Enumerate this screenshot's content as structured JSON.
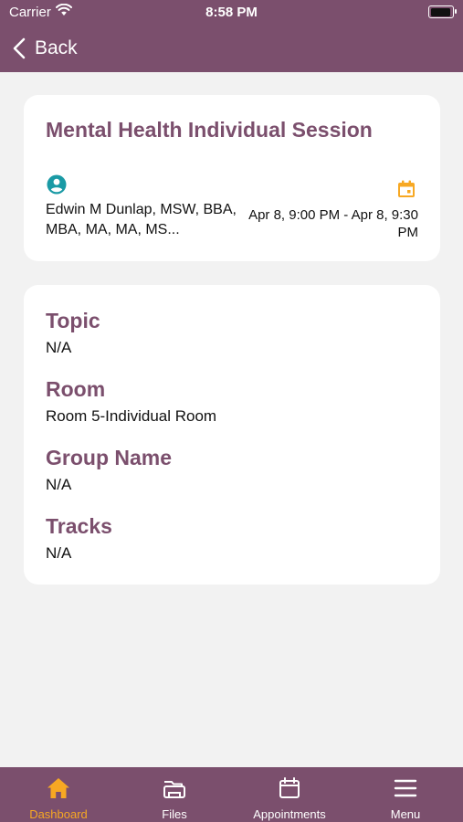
{
  "status_bar": {
    "carrier": "Carrier",
    "time": "8:58 PM"
  },
  "nav": {
    "back_label": "Back"
  },
  "session": {
    "title": "Mental Health Individual Session",
    "provider": "Edwin M Dunlap, MSW, BBA, MBA, MA, MA, MS...",
    "datetime": "Apr 8, 9:00 PM - Apr 8, 9:30 PM"
  },
  "details": [
    {
      "label": "Topic",
      "value": "N/A"
    },
    {
      "label": "Room",
      "value": "Room 5-Individual Room"
    },
    {
      "label": "Group Name",
      "value": "N/A"
    },
    {
      "label": "Tracks",
      "value": "N/A"
    }
  ],
  "tabs": [
    {
      "label": "Dashboard",
      "icon": "home-icon",
      "active": true
    },
    {
      "label": "Files",
      "icon": "files-icon",
      "active": false
    },
    {
      "label": "Appointments",
      "icon": "calendar-icon",
      "active": false
    },
    {
      "label": "Menu",
      "icon": "menu-icon",
      "active": false
    }
  ],
  "colors": {
    "brand_purple": "#7b4f6d",
    "accent_orange": "#f7a823",
    "teal": "#1a9aa5",
    "background": "#f2f2f2"
  }
}
